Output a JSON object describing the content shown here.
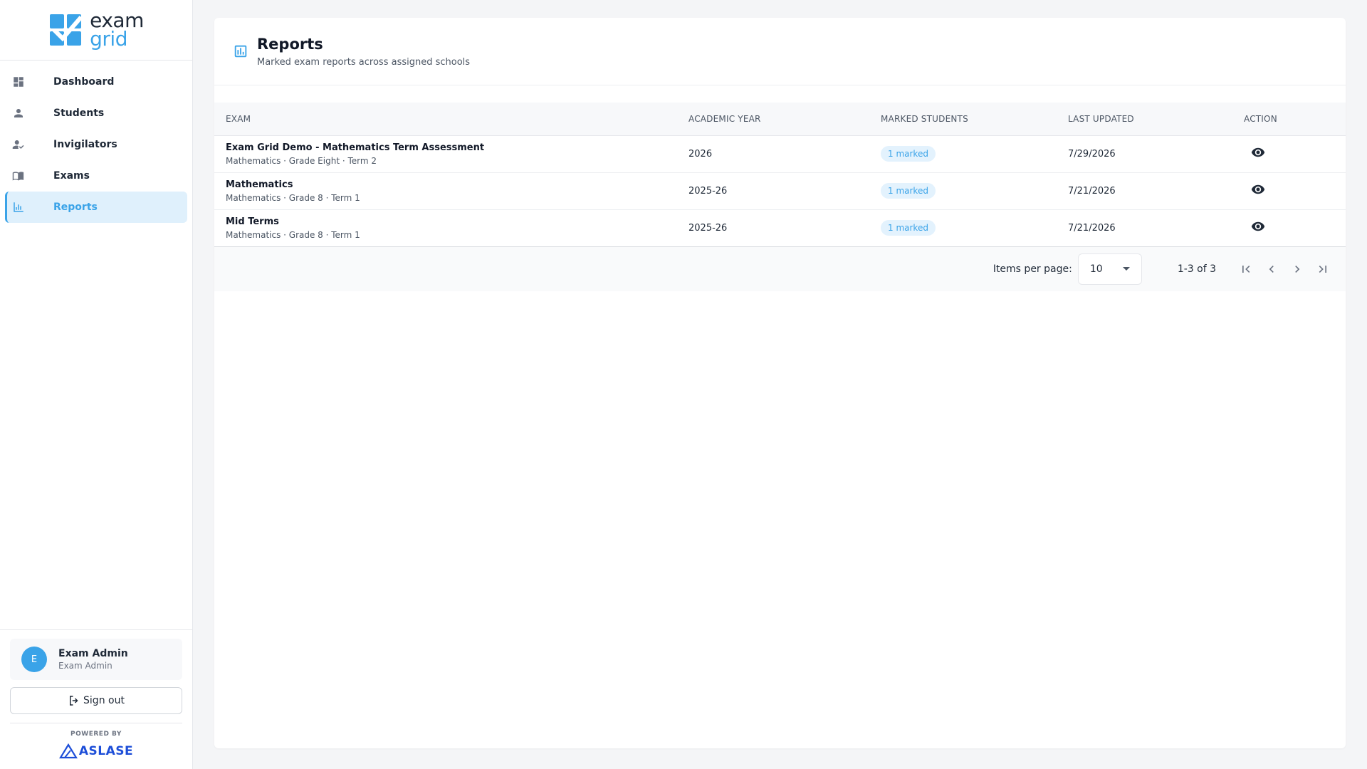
{
  "brand": {
    "logo_line1": "exam",
    "logo_line2": "grid",
    "accent": "#3aa3e8"
  },
  "sidebar": {
    "items": [
      {
        "label": "Dashboard",
        "icon": "dashboard-icon"
      },
      {
        "label": "Students",
        "icon": "person-icon"
      },
      {
        "label": "Invigilators",
        "icon": "person-check-icon"
      },
      {
        "label": "Exams",
        "icon": "book-icon"
      },
      {
        "label": "Reports",
        "icon": "bar-chart-icon",
        "active": true
      }
    ],
    "user": {
      "initial": "E",
      "name": "Exam Admin",
      "role": "Exam Admin"
    },
    "signout_label": "Sign out",
    "powered_by": "POWERED BY",
    "powered_brand": "ASLASE"
  },
  "page": {
    "title": "Reports",
    "subtitle": "Marked exam reports across assigned schools"
  },
  "table": {
    "headers": [
      "EXAM",
      "ACADEMIC YEAR",
      "MARKED STUDENTS",
      "LAST UPDATED",
      "ACTION"
    ],
    "rows": [
      {
        "title": "Exam Grid Demo - Mathematics Term Assessment",
        "sub": "Mathematics · Grade Eight · Term 2",
        "year": "2026",
        "marked": "1 marked",
        "updated": "7/29/2026"
      },
      {
        "title": "Mathematics",
        "sub": "Mathematics · Grade 8 · Term 1",
        "year": "2025-26",
        "marked": "1 marked",
        "updated": "7/21/2026"
      },
      {
        "title": "Mid Terms",
        "sub": "Mathematics · Grade 8 · Term 1",
        "year": "2025-26",
        "marked": "1 marked",
        "updated": "7/21/2026"
      }
    ]
  },
  "paginator": {
    "items_per_page_label": "Items per page:",
    "items_per_page": "10",
    "range": "1-3 of 3"
  }
}
